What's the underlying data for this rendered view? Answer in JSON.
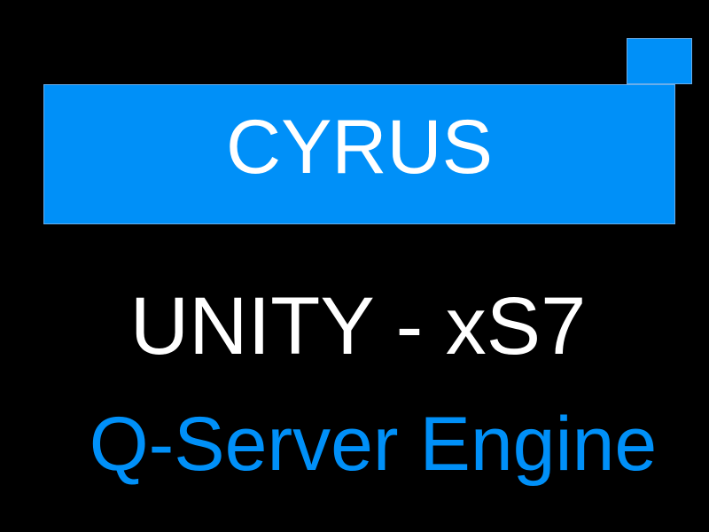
{
  "brand": {
    "label": "CYRUS"
  },
  "headline": "UNITY - xS7",
  "subline": "Q-Server Engine",
  "colors": {
    "background": "#000000",
    "accent": "#0090f8",
    "text": "#ffffff"
  }
}
